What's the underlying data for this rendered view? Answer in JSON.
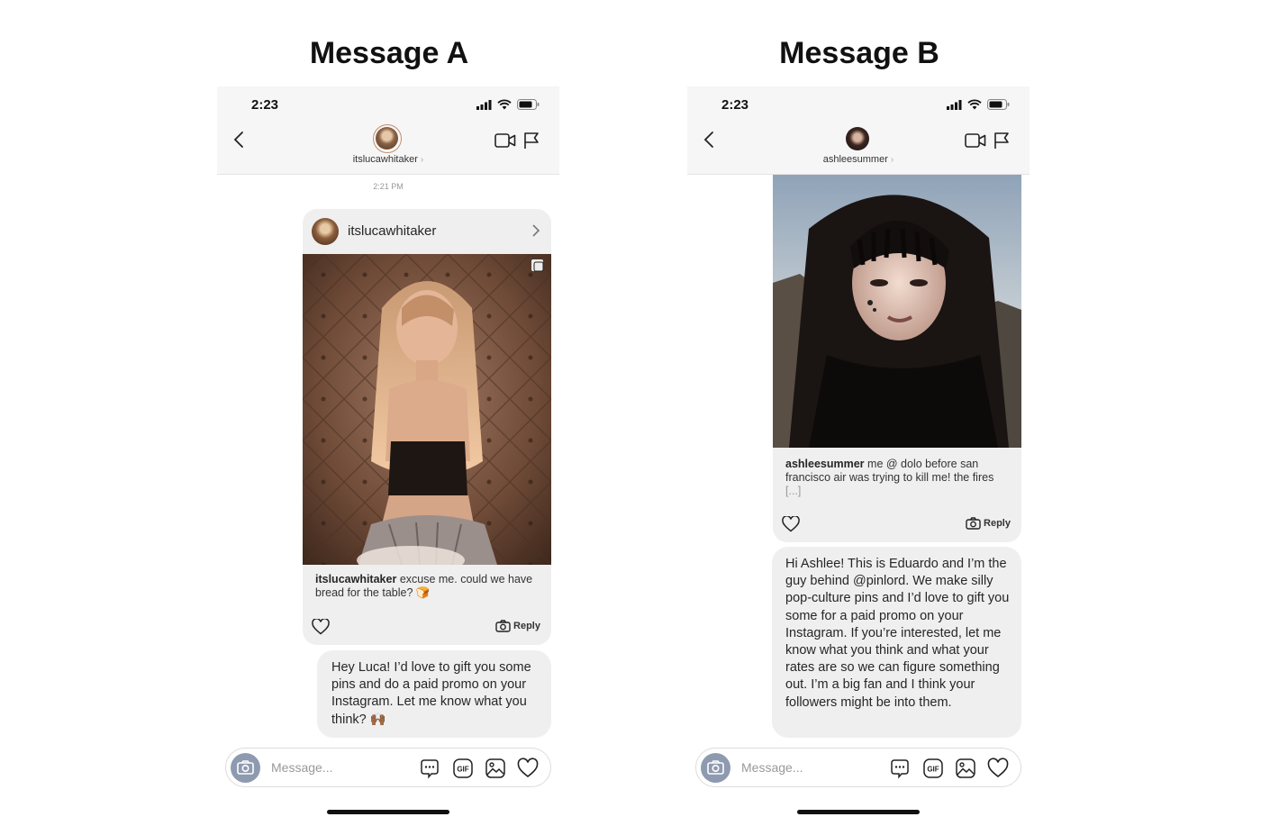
{
  "headings": {
    "a": "Message A",
    "b": "Message B"
  },
  "phone_a": {
    "time": "2:23",
    "header_username": "itslucawhitaker",
    "timestamp": "2:21 PM",
    "post": {
      "username": "itslucawhitaker",
      "caption_user": "itslucawhitaker",
      "caption_text": "excuse me. could we have bread for the table? 🍞",
      "reply_label": "Reply"
    },
    "bubble": "Hey Luca! I’d love to gift you some pins and do a paid promo on your Instagram. Let me know what you think? 🙌🏾",
    "composer_placeholder": "Message..."
  },
  "phone_b": {
    "time": "2:23",
    "header_username": "ashleesummer",
    "post": {
      "caption_user": "ashleesummer",
      "caption_text": "me @ dolo before san francisco air was trying to kill me! the fires",
      "caption_more": "[...]",
      "reply_label": "Reply"
    },
    "bubble": "Hi Ashlee! This is Eduardo and I’m the guy behind @pinlord. We make silly pop-culture pins and I’d love to gift you some for a paid promo on your Instagram. If you’re interested, let me know what you think and what your rates are so we can figure something out. I’m a big fan and I think your followers might be into them.",
    "composer_placeholder": "Message..."
  },
  "colors": {
    "bubble": "#efefef",
    "header_bg": "#f6f6f6",
    "camera_button": "#8e9aaf",
    "avatar_ring": "#c48e6a"
  },
  "icons": [
    "back-chevron-icon",
    "video-call-icon",
    "flag-icon",
    "heart-icon",
    "camera-icon",
    "sticker-icon",
    "gif-icon",
    "gallery-icon",
    "signal-icon",
    "wifi-icon",
    "battery-icon"
  ]
}
